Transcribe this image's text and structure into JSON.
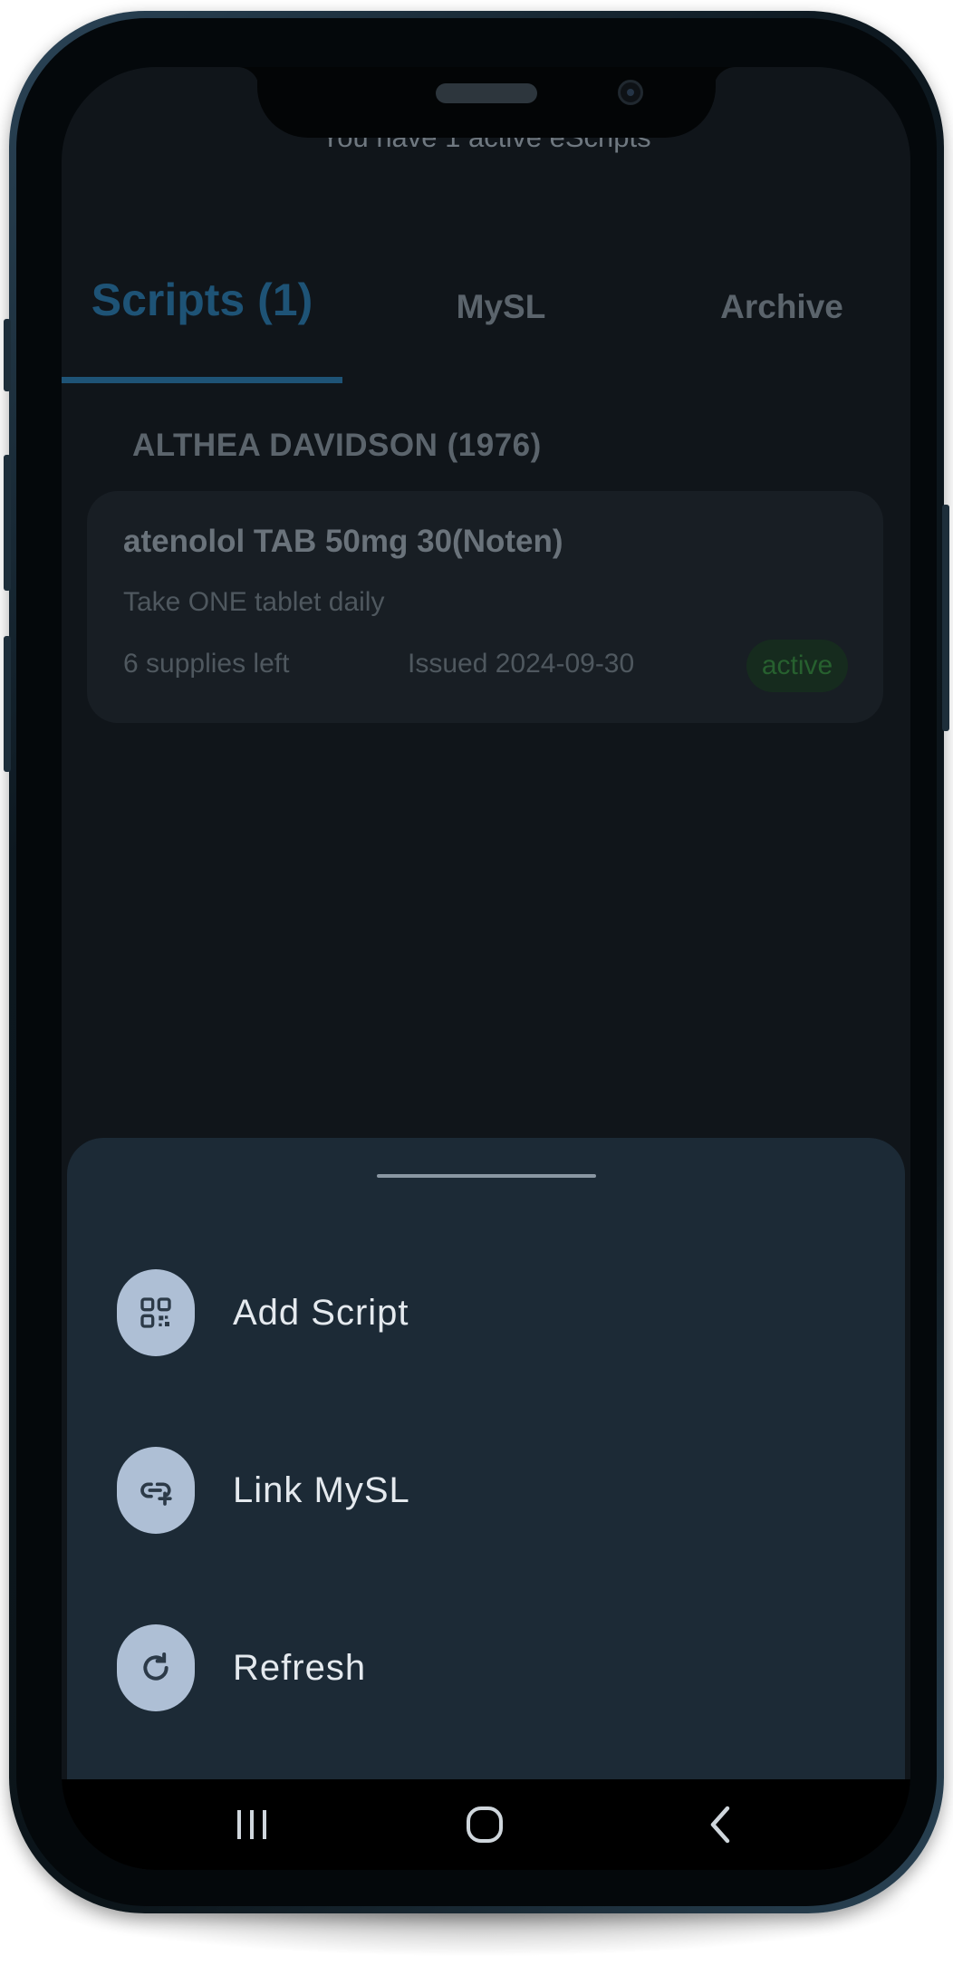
{
  "subtitle": "You have 1 active eScripts",
  "tabs": {
    "scripts": "Scripts (1)",
    "mysl": "MySL",
    "archive": "Archive"
  },
  "patient": {
    "name": "ALTHEA DAVIDSON (1976)"
  },
  "script_card": {
    "drug": "atenolol TAB 50mg 30(Noten)",
    "directions": "Take ONE tablet daily",
    "supplies": "6 supplies left",
    "issued": "Issued 2024-09-30",
    "status": "active"
  },
  "sheet": {
    "items": [
      {
        "label": "Add Script",
        "icon": "qr-code-icon"
      },
      {
        "label": "Link MySL",
        "icon": "link-add-icon"
      },
      {
        "label": "Refresh",
        "icon": "refresh-icon"
      }
    ]
  },
  "navbar": {
    "recents_icon": "recents-icon",
    "home_icon": "home-icon",
    "back_icon": "back-icon"
  },
  "colors": {
    "accent": "#1e5376",
    "sheet_bg": "#1c2a36",
    "icon_bg": "#aebfd5",
    "status_green": "#27602f"
  }
}
